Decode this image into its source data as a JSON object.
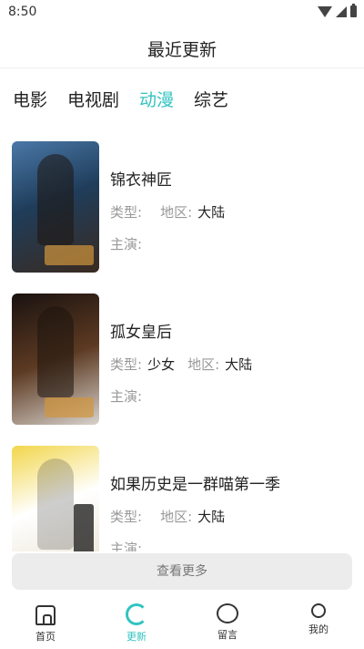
{
  "status_bar": {
    "time": "8:50"
  },
  "header": {
    "title": "最近更新"
  },
  "tabs": [
    {
      "label": "电影",
      "active": false
    },
    {
      "label": "电视剧",
      "active": false
    },
    {
      "label": "动漫",
      "active": true
    },
    {
      "label": "综艺",
      "active": false
    }
  ],
  "items": [
    {
      "title": "锦衣神匠",
      "type_label": "类型:",
      "type_value": "",
      "region_label": "地区:",
      "region_value": "大陆",
      "cast_label": "主演:"
    },
    {
      "title": "孤女皇后",
      "type_label": "类型:",
      "type_value": "少女",
      "region_label": "地区:",
      "region_value": "大陆",
      "cast_label": "主演:"
    },
    {
      "title": "如果历史是一群喵第一季",
      "type_label": "类型:",
      "type_value": "",
      "region_label": "地区:",
      "region_value": "大陆",
      "cast_label": "主演:"
    }
  ],
  "more_button": "查看更多",
  "bottom_nav": [
    {
      "label": "首页",
      "icon": "home-icon",
      "active": false
    },
    {
      "label": "更新",
      "icon": "refresh-icon",
      "active": true
    },
    {
      "label": "留言",
      "icon": "comment-icon",
      "active": false
    },
    {
      "label": "我的",
      "icon": "user-icon",
      "active": false
    }
  ],
  "colors": {
    "accent": "#32c3c0",
    "muted": "#999999",
    "button_bg": "#ececec"
  }
}
